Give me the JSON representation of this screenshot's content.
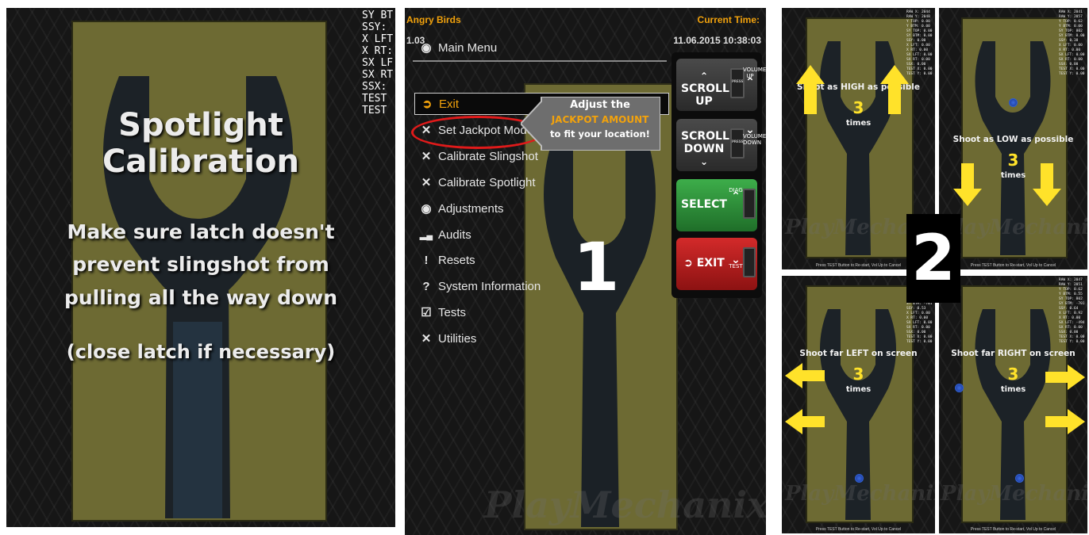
{
  "panel_a": {
    "title_line1": "Spotlight",
    "title_line2": "Calibration",
    "body_line1": "Make sure latch doesn't",
    "body_line2": "prevent slingshot from",
    "body_line3": "pulling all the way down",
    "body_line4": "(close latch if necessary)",
    "debug_text": "SY BT\nSSY:\nX LFT\nX RT:\nSX LF\nSX RT\nSSX:\nTEST\nTEST"
  },
  "panel_b": {
    "game_title": "Angry Birds",
    "version": "1.03",
    "time_label": "Current Time:",
    "datetime": "11.06.2015 10:38:03",
    "menu_header": "Main Menu",
    "menu_items": [
      {
        "label": "Exit",
        "icon": "exit-icon"
      },
      {
        "label": "Set Jackpot Mode",
        "icon": "tools-icon"
      },
      {
        "label": "Calibrate Slingshot",
        "icon": "tools-icon"
      },
      {
        "label": "Calibrate Spotlight",
        "icon": "tools-icon"
      },
      {
        "label": "Adjustments",
        "icon": "piggy-icon"
      },
      {
        "label": "Audits",
        "icon": "bars-icon"
      },
      {
        "label": "Resets",
        "icon": "exclamation-icon"
      },
      {
        "label": "System Information",
        "icon": "question-icon"
      },
      {
        "label": "Tests",
        "icon": "checkbox-icon"
      },
      {
        "label": "Utilities",
        "icon": "tools-icon"
      }
    ],
    "callout_line1": "Adjust the",
    "callout_line2": "JACKPOT AMOUNT",
    "callout_line3": "to fit your location!",
    "step_number": "1",
    "buttons": {
      "scroll_up_line1": "SCROLL",
      "scroll_up_line2": "UP",
      "scroll_up_mini": "VOLUME UP",
      "scroll_down_line1": "SCROLL",
      "scroll_down_line2": "DOWN",
      "scroll_down_mini": "VOLUME DOWN",
      "select": "SELECT",
      "select_mini": "DIAG",
      "exit": "EXIT",
      "exit_mini": "TEST",
      "press": "PRESS"
    },
    "accent_colors": {
      "orange": "#f2a20c",
      "green": "#2f9a3c",
      "red": "#c92020",
      "gray": "#3a3a3a"
    }
  },
  "panel_c": {
    "step_number": "2",
    "footer": "Press TEST Button to Re-start, Vol Up to Cancel",
    "times_label": "times",
    "count": "3",
    "watermark": "PlayMechanix",
    "screens": [
      {
        "instruction": "Shoot as HIGH as possible",
        "debug": "RAW X: 2044\nRAW Y: 2048\nY TOP: 0.00\nY BTM: 0.00\nSY TOP: 0.00\nSY BTM: 0.00\nSSY: 0.00\nX LFT: 0.00\nX RT: 0.00\nSX LFT: 0.00\nSX RT: 0.00\nSSX: 0.00\nTEST X: 0.00\nTEST Y: 0.00"
      },
      {
        "instruction": "Shoot as LOW as possible",
        "debug": "RAW X: 2041\nRAW Y: 2057\nY TOP: 0.62\nY BTM: 0.00\nSY TOP: 802\nSY BTM: 0.00\nSSY: 0.38\nX LFT: 0.00\nX RT: 0.00\nSX LFT: 0.00\nSX RT: 0.00\nSSX: 0.00\nTEST X: 0.00\nTEST Y: 0.00"
      },
      {
        "instruction": "Shoot far LEFT on screen",
        "debug": "RAW X: 2047\nRAW Y: 2051\nY TOP: 0.62\nY BTM: 0.55\nSY TOP: 802\nSY BTM: -701\nSSY: 0.53\nX LFT: 0.00\nX RT: 0.00\nSX LFT: 0.00\nSX RT: 0.00\nSSX: 0.00\nTEST X: 0.00\nTEST Y: 0.00"
      },
      {
        "instruction": "Shoot far RIGHT on screen",
        "debug": "RAW X: 2047\nRAW Y: 2051\nY TOP: 0.62\nY BTM: 0.55\nSY TOP: 802\nSY BTM: -701\nSSY: 0.64\nX LFT: 0.92\nX RT: 0.00\nSX LFT: -494\nSX RT: 0.00\nSSX: 0.00\nTEST X: 0.00\nTEST Y: 0.00"
      }
    ]
  }
}
